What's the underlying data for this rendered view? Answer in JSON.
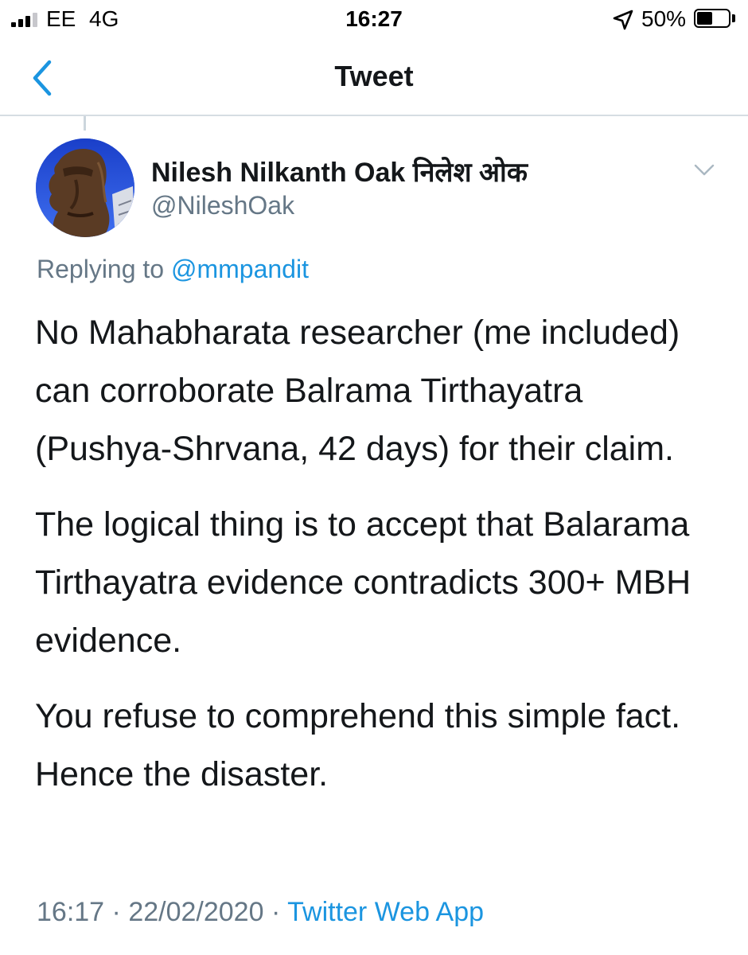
{
  "status_bar": {
    "carrier": "EE",
    "network": "4G",
    "time": "16:27",
    "battery_percent": "50%",
    "battery_level": 0.5
  },
  "nav": {
    "title": "Tweet",
    "back_icon": "chevron-left-icon"
  },
  "tweet": {
    "author_name": "Nilesh Nilkanth Oak निलेश ओक",
    "author_handle": "@NileshOak",
    "replying_prefix": "Replying to",
    "replying_to": "@mmpandit",
    "paragraphs": [
      "No Mahabharata researcher (me included) can corroborate Balrama Tirthayatra (Pushya-Shrvana, 42 days) for their claim.",
      "The logical thing is to accept that Balarama Tirthayatra evidence contradicts 300+ MBH evidence.",
      "You refuse to comprehend this simple fact. Hence the disaster."
    ],
    "time": "16:17",
    "date": "22/02/2020",
    "separator": "·",
    "source": "Twitter Web App"
  },
  "colors": {
    "accent": "#1b95e0",
    "secondary_text": "#657786",
    "primary_text": "#14171a"
  }
}
